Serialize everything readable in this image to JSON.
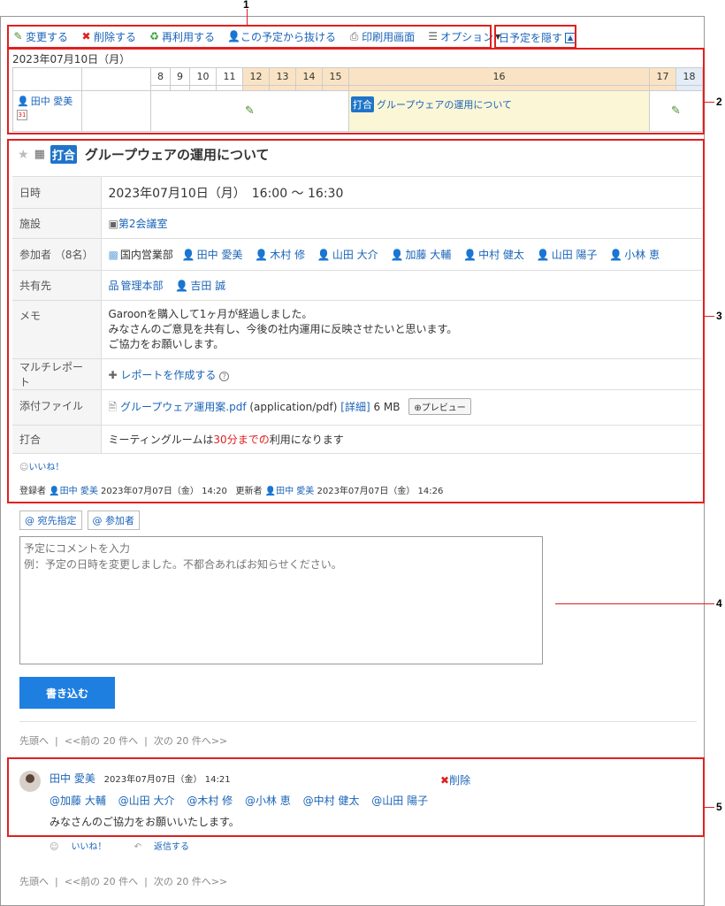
{
  "toolbar": {
    "edit": "変更する",
    "delete": "削除する",
    "reuse": "再利用する",
    "leave": "この予定から抜ける",
    "print": "印刷用画面",
    "options": "オプション"
  },
  "hide_day_schedule": "日予定を隠す",
  "day": {
    "date": "2023年07月10日（月）",
    "hours": [
      "8",
      "9",
      "10",
      "11",
      "12",
      "13",
      "14",
      "15",
      "16",
      "17",
      "18"
    ],
    "user": "田中 愛美",
    "event_badge": "打合",
    "event_title": "グループウェアの運用について"
  },
  "detail": {
    "badge": "打合",
    "title": "グループウェアの運用について",
    "rows": {
      "datetime_label": "日時",
      "datetime_value": "2023年07月10日（月）　16:00 ～ 16:30",
      "facility_label": "施設",
      "facility_value": "第2会議室",
      "attendees_label": "参加者 （8名）",
      "attendees": [
        "国内営業部",
        "田中 愛美",
        "木村 修",
        "山田 大介",
        "加藤 大輔",
        "中村 健太",
        "山田 陽子",
        "小林 恵"
      ],
      "share_label": "共有先",
      "share": [
        "管理本部",
        "吉田 誠"
      ],
      "memo_label": "メモ",
      "memo_lines": [
        "Garoonを購入して1ヶ月が経過しました。",
        "みなさんのご意見を共有し、今後の社内運用に反映させたいと思います。",
        "ご協力をお願いします。"
      ],
      "report_label": "マルチレポート",
      "report_link": "レポートを作成する",
      "attach_label": "添付ファイル",
      "attach_name": "グループウェア運用案.pdf",
      "attach_type": "(application/pdf)",
      "attach_detail": "[詳細]",
      "attach_size": "6 MB",
      "attach_preview": "プレビュー",
      "meeting_label": "打合",
      "meeting_pre": "ミーティングルームは",
      "meeting_red": "30分までの",
      "meeting_post": "利用になります"
    },
    "like": "いいね！",
    "meta_registrar_label": "登録者",
    "meta_registrar": "田中 愛美",
    "meta_registered": "2023年07月07日（金） 14:20",
    "meta_updater_label": "更新者",
    "meta_updater": "田中 愛美",
    "meta_updated": "2023年07月07日（金） 14:26"
  },
  "comment_form": {
    "mention_to": "宛先指定",
    "mention_attendees": "参加者",
    "placeholder": "予定にコメントを入力\n例：予定の日時を変更しました。不都合あればお知らせください。",
    "submit": "書き込む"
  },
  "pager": {
    "first": "先頭へ",
    "prev": "<<前の 20 件へ",
    "next": "次の 20 件へ>>"
  },
  "comment": {
    "author": "田中 愛美",
    "time": "2023年07月07日（金） 14:21",
    "delete": "削除",
    "mentions": [
      "@加藤 大輔",
      "@山田 大介",
      "@木村 修",
      "@小林 恵",
      "@中村 健太",
      "@山田 陽子"
    ],
    "body": "みなさんのご協力をお願いいたします。",
    "like": "いいね！",
    "reply": "返信する"
  },
  "callouts": [
    "1",
    "2",
    "3",
    "4",
    "5"
  ],
  "colors": {
    "callout": "#e02020",
    "link": "#1a64b8",
    "busy": "#fae3c4",
    "submit": "#1f7fe0"
  }
}
